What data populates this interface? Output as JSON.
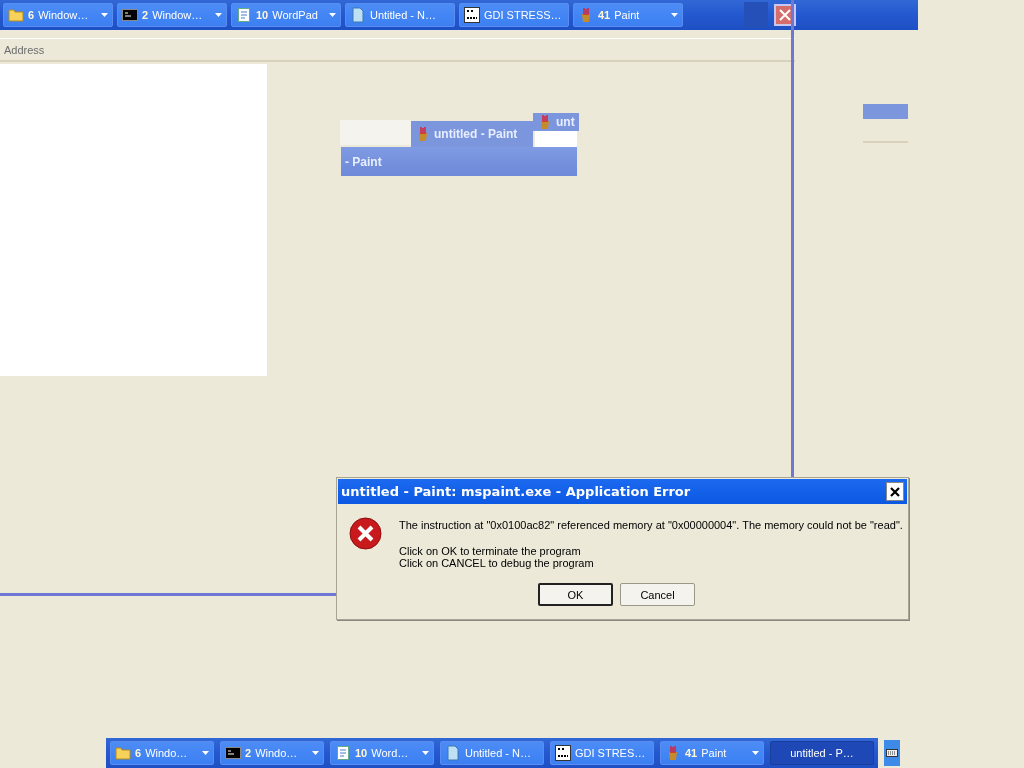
{
  "top_taskbar": {
    "buttons": [
      {
        "kind": "folder",
        "count": "6",
        "label": "Window…",
        "grouped": true,
        "selected": false
      },
      {
        "kind": "console",
        "count": "2",
        "label": "Window…",
        "grouped": true,
        "selected": false
      },
      {
        "kind": "notepad",
        "count": "10",
        "label": "WordPad",
        "grouped": true,
        "selected": false
      },
      {
        "kind": "document",
        "label": "Untitled - N…",
        "grouped": false,
        "selected": false
      },
      {
        "kind": "stress",
        "label": "GDI STRESS…",
        "grouped": false,
        "selected": false
      },
      {
        "kind": "paint",
        "count": "41",
        "label": "Paint",
        "grouped": true,
        "selected": false
      }
    ]
  },
  "explorer": {
    "address_label": "Address"
  },
  "paint_fragments": {
    "tab_title": "untitled - Paint",
    "corner_title": "unt",
    "bar_title": "- Paint"
  },
  "error_dialog": {
    "title": "untitled - Paint: mspaint.exe - Application Error",
    "message": "The instruction at \"0x0100ac82\" referenced memory at \"0x00000004\". The memory could not be \"read\".",
    "instructions": [
      "Click on OK to terminate the program",
      "Click on CANCEL to debug the program"
    ],
    "buttons": [
      {
        "label": "OK",
        "selected": true
      },
      {
        "label": "Cancel",
        "selected": false
      }
    ]
  },
  "bottom_taskbar": {
    "buttons": [
      {
        "kind": "folder",
        "count": "6",
        "label": "Windo…",
        "grouped": true,
        "selected": false
      },
      {
        "kind": "console",
        "count": "2",
        "label": "Windo…",
        "grouped": true,
        "selected": false
      },
      {
        "kind": "notepad",
        "count": "10",
        "label": "Word…",
        "grouped": true,
        "selected": false
      },
      {
        "kind": "document",
        "label": "Untitled - N…",
        "grouped": false,
        "selected": false
      },
      {
        "kind": "stress",
        "label": "GDI STRES…",
        "grouped": false,
        "selected": false
      },
      {
        "kind": "paint",
        "count": "41",
        "label": "Paint",
        "grouped": true,
        "selected": false
      },
      {
        "kind": "none",
        "label": "untitled - P…",
        "grouped": false,
        "selected": true
      }
    ]
  }
}
